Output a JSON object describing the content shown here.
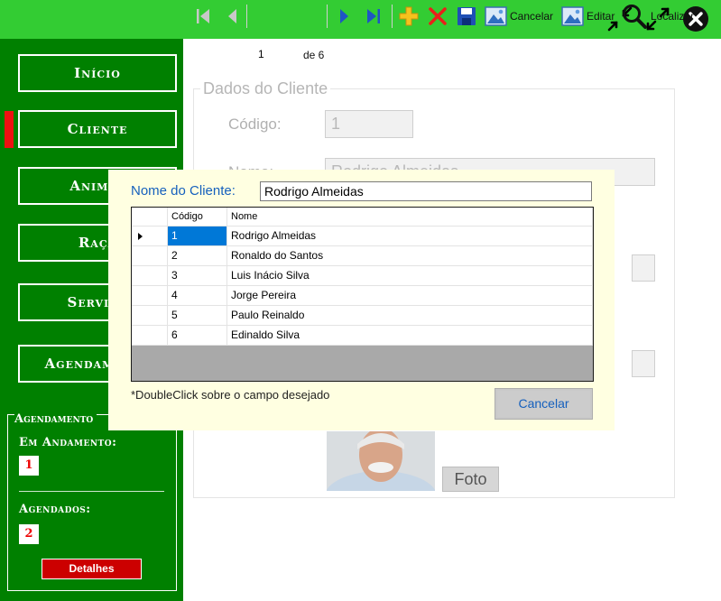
{
  "colors": {
    "topbar": "#33cc33",
    "sidebar": "#008000",
    "accent_red": "#cc0000",
    "link_blue": "#1560bd"
  },
  "window_controls": [
    {
      "name": "restore-icon"
    },
    {
      "name": "maximize-icon"
    },
    {
      "name": "close-icon"
    }
  ],
  "sidebar": {
    "items": [
      {
        "label": "Início"
      },
      {
        "label": "Cliente",
        "active": true
      },
      {
        "label": "Animal"
      },
      {
        "label": "Raça"
      },
      {
        "label": "Serviço"
      },
      {
        "label": "Agendamento"
      }
    ],
    "agendamento": {
      "title": "Agendamento",
      "em_andamento_label": "Em Andamento:",
      "em_andamento_count": "1",
      "agendados_label": "Agendados:",
      "agendados_count": "2",
      "detalhes_label": "Detalhes"
    }
  },
  "toolbar": {
    "position": "1",
    "of_total": "de 6",
    "cancelar_label": "Cancelar",
    "editar_label": "Editar",
    "localizar_label": "Localizar",
    "icons": [
      "first-record-icon",
      "previous-record-icon",
      "next-record-icon",
      "last-record-icon",
      "add-icon",
      "delete-icon",
      "save-icon",
      "image-icon",
      "search-icon"
    ]
  },
  "form": {
    "group_title": "Dados do Cliente",
    "codigo_label": "Código:",
    "codigo_value": "1",
    "nome_label": "Nome:",
    "nome_value": "Rodrigo Almeidas",
    "foto_label": "Foto"
  },
  "popup": {
    "search_label": "Nome do Cliente:",
    "search_value": "Rodrigo Almeidas",
    "columns": [
      "Código",
      "Nome"
    ],
    "rows": [
      {
        "codigo": "1",
        "nome": "Rodrigo Almeidas",
        "selected": true
      },
      {
        "codigo": "2",
        "nome": "Ronaldo do Santos"
      },
      {
        "codigo": "3",
        "nome": "Luis Inácio Silva"
      },
      {
        "codigo": "4",
        "nome": "Jorge Pereira"
      },
      {
        "codigo": "5",
        "nome": "Paulo Reinaldo"
      },
      {
        "codigo": "6",
        "nome": "Edinaldo Silva"
      }
    ],
    "hint": "*DoubleClick sobre o campo desejado",
    "cancel_label": "Cancelar"
  }
}
